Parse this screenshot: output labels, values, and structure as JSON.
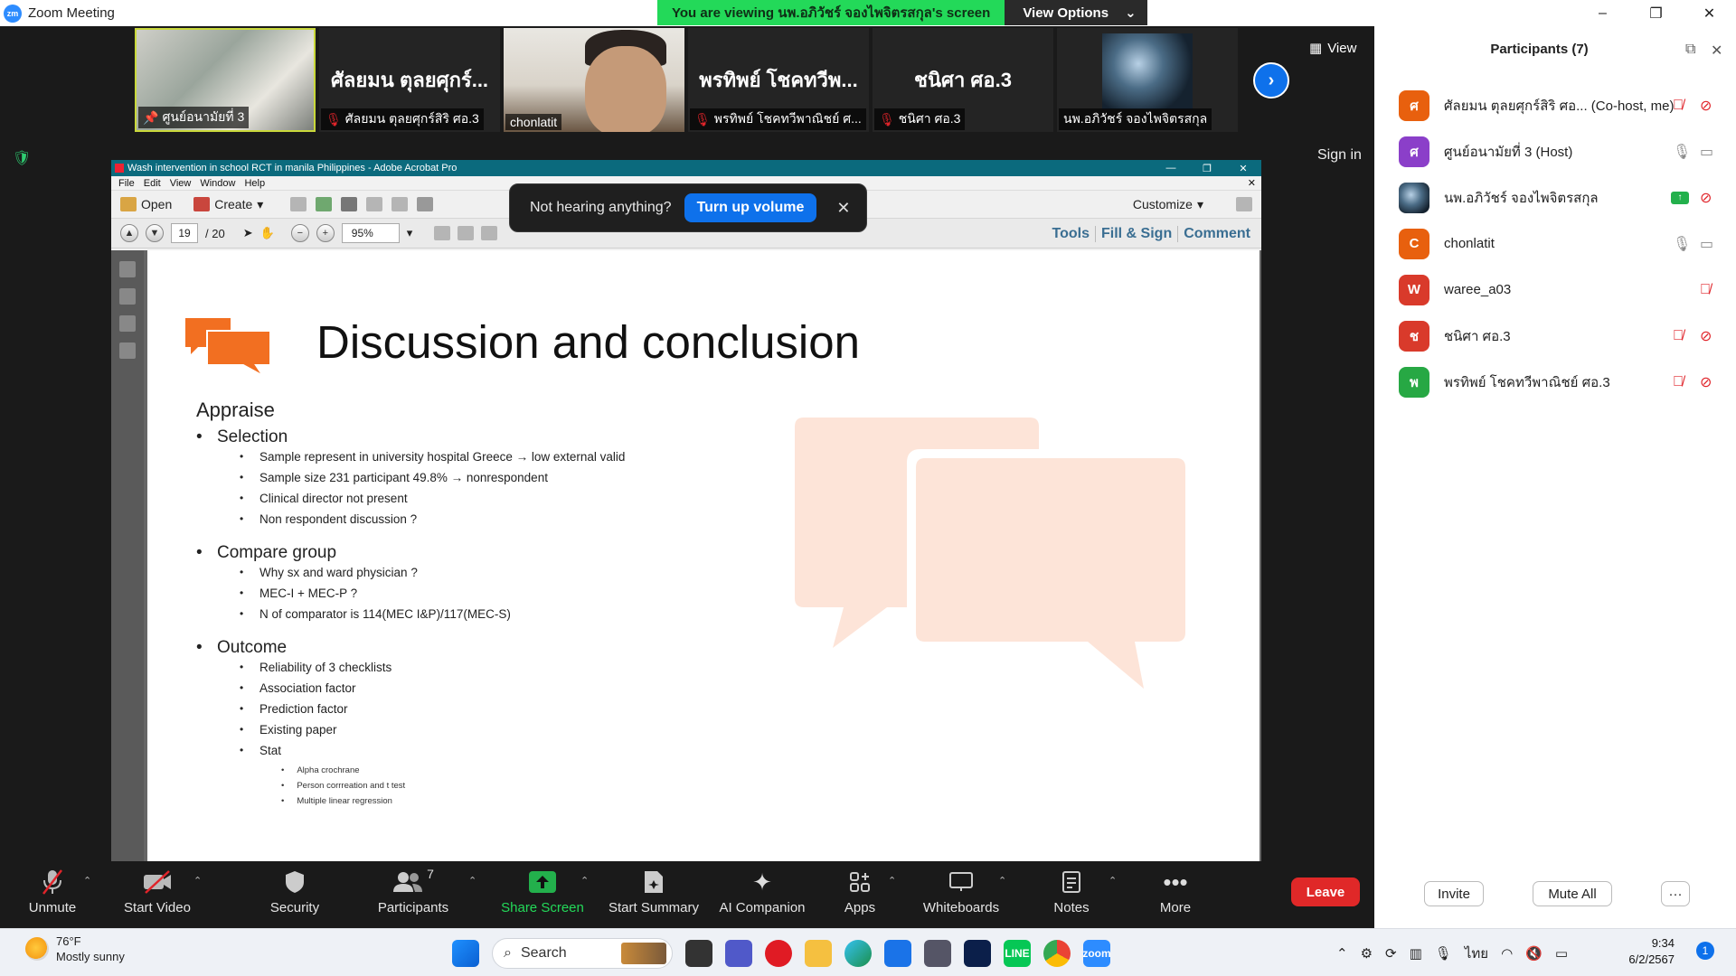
{
  "window": {
    "title": "Zoom Meeting",
    "minimize": "–",
    "maximize": "❐",
    "close": "✕"
  },
  "banner": {
    "viewing_text": "You are viewing นพ.อภิวัชร์ จองไพจิตรสกุล's screen",
    "view_options": "View Options",
    "caret": "⌄"
  },
  "video_strip": {
    "tiles": [
      {
        "type": "photo",
        "label": "ศูนย์อนามัยที่ 3",
        "label_icon": "pin-icon"
      },
      {
        "type": "name",
        "display": "ศัลยมน ตุลยศุกร์...",
        "label": "ศัลยมน ตุลยศุกร์สิริ ศอ.3",
        "muted": true
      },
      {
        "type": "photo",
        "label": "chonlatit"
      },
      {
        "type": "name",
        "display": "พรทิพย์ โชคทวีพ...",
        "label": "พรทิพย์ โชคทวีพาณิชย์ ศ...",
        "muted": true
      },
      {
        "type": "name",
        "display": "ชนิศา ศอ.3",
        "label": "ชนิศา ศอ.3",
        "muted": true
      },
      {
        "type": "photo",
        "label": "นพ.อภิวัชร์ จองไพจิตรสกุล"
      }
    ],
    "next": "›",
    "view": "View"
  },
  "sign_in": "Sign in",
  "audio_popup": {
    "text": "Not hearing anything?",
    "button": "Turn up volume",
    "close": "✕"
  },
  "acrobat": {
    "title": "Wash intervention in school RCT in manila Philippines - Adobe Acrobat Pro",
    "menu": [
      "File",
      "Edit",
      "View",
      "Window",
      "Help"
    ],
    "open": "Open",
    "create": "Create",
    "customize": "Customize",
    "page_current": "19",
    "page_total": "/ 20",
    "zoom": "95%",
    "links": [
      "Tools",
      "Fill & Sign",
      "Comment"
    ]
  },
  "slide": {
    "title": "Discussion and conclusion",
    "heading": "Appraise",
    "bullet": "•",
    "sections": [
      {
        "name": "Selection",
        "items": [
          "Sample represent in university hospital Greece → low external valid",
          "Sample size 231 participant 49.8% → nonrespondent",
          "Clinical director not present",
          "Non respondent discussion ?"
        ]
      },
      {
        "name": "Compare group",
        "items": [
          "Why sx and ward physician ?",
          "MEC-I + MEC-P ?",
          "N of comparator is  114(MEC I&P)/117(MEC-S)"
        ]
      },
      {
        "name": "Outcome",
        "items": [
          "Reliability of 3 checklists",
          "Association factor",
          "Prediction factor",
          "Existing paper",
          "Stat"
        ],
        "sub_items": [
          "Alpha crochrane",
          "Person corrreation and t test",
          "Multiple linear regression"
        ]
      }
    ]
  },
  "toolbar": {
    "unmute": "Unmute",
    "start_video": "Start Video",
    "security": "Security",
    "participants": "Participants",
    "participants_count": "7",
    "share_screen": "Share Screen",
    "start_summary": "Start Summary",
    "ai_companion": "AI Companion",
    "apps": "Apps",
    "whiteboards": "Whiteboards",
    "notes": "Notes",
    "more": "More",
    "leave": "Leave",
    "caret": "⌃"
  },
  "participants_panel": {
    "title": "Participants (7)",
    "list": [
      {
        "initial": "ศ",
        "name": "ศัลยมน ตุลยศุกร์สิริ ศอ... (Co-host, me)",
        "color": "#e8600e",
        "mic": "muted",
        "video": "off"
      },
      {
        "initial": "ศ",
        "name": "ศูนย์อนามัยที่ 3 (Host)",
        "color": "#8b3fc9",
        "mic": "on",
        "video": "on"
      },
      {
        "initial": "",
        "name": "นพ.อภิวัชร์ จองไพจิตรสกุล",
        "color": "#34495e",
        "mic": "sharing",
        "video": "off"
      },
      {
        "initial": "C",
        "name": "chonlatit",
        "color": "#e8600e",
        "mic": "on",
        "video": "on"
      },
      {
        "initial": "W",
        "name": "waree_a03",
        "color": "#d93a2b",
        "mic": "none",
        "video": "muted_only"
      },
      {
        "initial": "ช",
        "name": "ชนิศา ศอ.3",
        "color": "#d93a2b",
        "mic": "muted",
        "video": "off"
      },
      {
        "initial": "พ",
        "name": "พรทิพย์ โชคทวีพาณิชย์ ศอ.3",
        "color": "#27a844",
        "mic": "muted",
        "video": "off"
      }
    ],
    "invite": "Invite",
    "mute_all": "Mute All",
    "more": "···"
  },
  "taskbar": {
    "temp": "76°F",
    "weather": "Mostly sunny",
    "search": "Search",
    "lang": "ไทย",
    "time": "9:34",
    "date": "6/2/2567",
    "notifications": "1"
  }
}
